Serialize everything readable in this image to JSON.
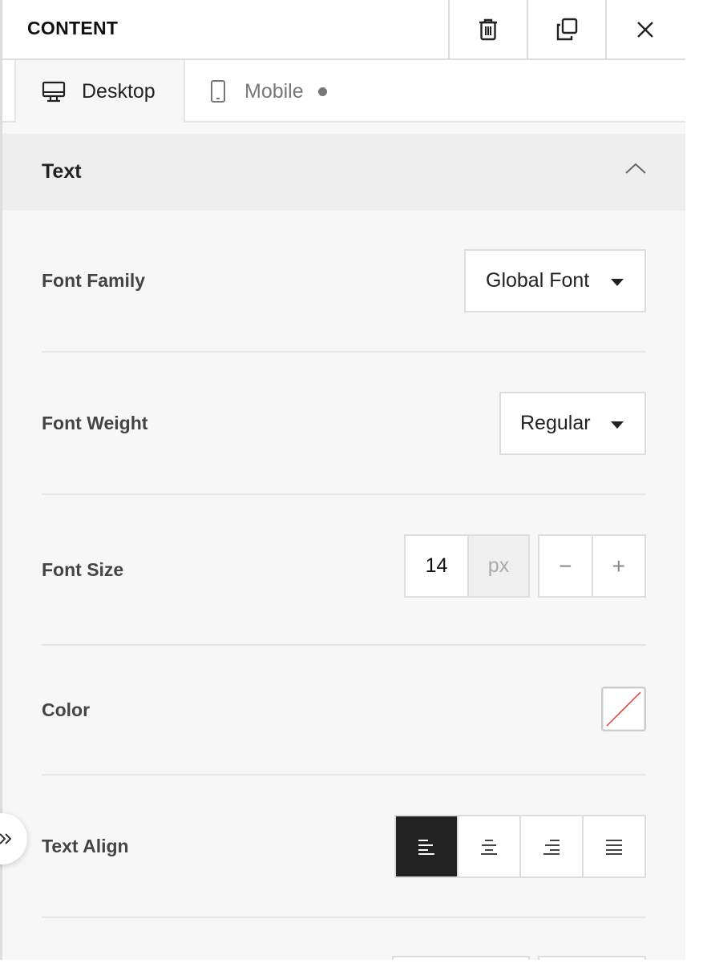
{
  "header": {
    "title": "CONTENT",
    "icons": [
      "trash-icon",
      "duplicate-icon",
      "close-icon"
    ]
  },
  "tabs": [
    {
      "label": "Desktop",
      "icon": "desktop-icon",
      "active": true
    },
    {
      "label": "Mobile",
      "icon": "mobile-icon",
      "active": false,
      "has_indicator": true
    }
  ],
  "section": {
    "title": "Text",
    "expanded": true
  },
  "fields": {
    "font_family": {
      "label": "Font Family",
      "value": "Global Font"
    },
    "font_weight": {
      "label": "Font Weight",
      "value": "Regular"
    },
    "font_size": {
      "label": "Font Size",
      "value": "14",
      "unit": "px",
      "decrement": "−",
      "increment": "+"
    },
    "color": {
      "label": "Color",
      "value": "none"
    },
    "text_align": {
      "label": "Text Align",
      "options": [
        "left",
        "center",
        "right",
        "justify"
      ],
      "selected": "left"
    }
  },
  "colors": {
    "active_bg": "#222222",
    "swatch_slash": "#e53935"
  }
}
